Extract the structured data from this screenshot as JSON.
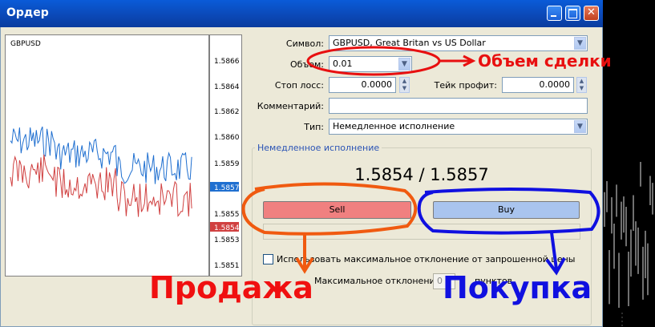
{
  "window": {
    "title": "Ордер"
  },
  "chart": {
    "symbol_label": "GBPUSD",
    "y_ticks": [
      "1.5866",
      "1.5864",
      "1.5862",
      "1.5860",
      "1.5859",
      "1.5857",
      "1.5855",
      "1.5854",
      "1.5853",
      "1.5851"
    ],
    "ask_marker": "1.5857",
    "bid_marker": "1.5854"
  },
  "form": {
    "symbol_label": "Символ:",
    "symbol_value": "GBPUSD, Great Britan vs US Dollar",
    "volume_label": "Объем:",
    "volume_value": "0.01",
    "stoploss_label": "Стоп лосс:",
    "stoploss_value": "0.0000",
    "takeprofit_label": "Тейк профит:",
    "takeprofit_value": "0.0000",
    "comment_label": "Комментарий:",
    "comment_value": "",
    "type_label": "Тип:",
    "type_value": "Немедленное исполнение"
  },
  "execution": {
    "group_title": "Немедленное исполнение",
    "price": "1.5854 / 1.5857",
    "sell_label": "Sell",
    "buy_label": "Buy",
    "deviation_checkbox_label": "Использовать максимальное отклонение от запрошенной цены",
    "max_deviation_label": "Максимальное отклонение:",
    "max_deviation_value": "0",
    "deviation_unit": "пунктов"
  },
  "annotations": {
    "volume_note": "Объем сделки",
    "sell_note": "Продажа",
    "buy_note": "Покупка"
  },
  "colors": {
    "sell_button": "#f08080",
    "buy_button": "#a9c4ee",
    "ask_line": "#1f6fd0",
    "bid_line": "#d04040",
    "annotation_red": "#e81010",
    "annotation_orange": "#f05a10",
    "annotation_blue": "#1010e0"
  }
}
